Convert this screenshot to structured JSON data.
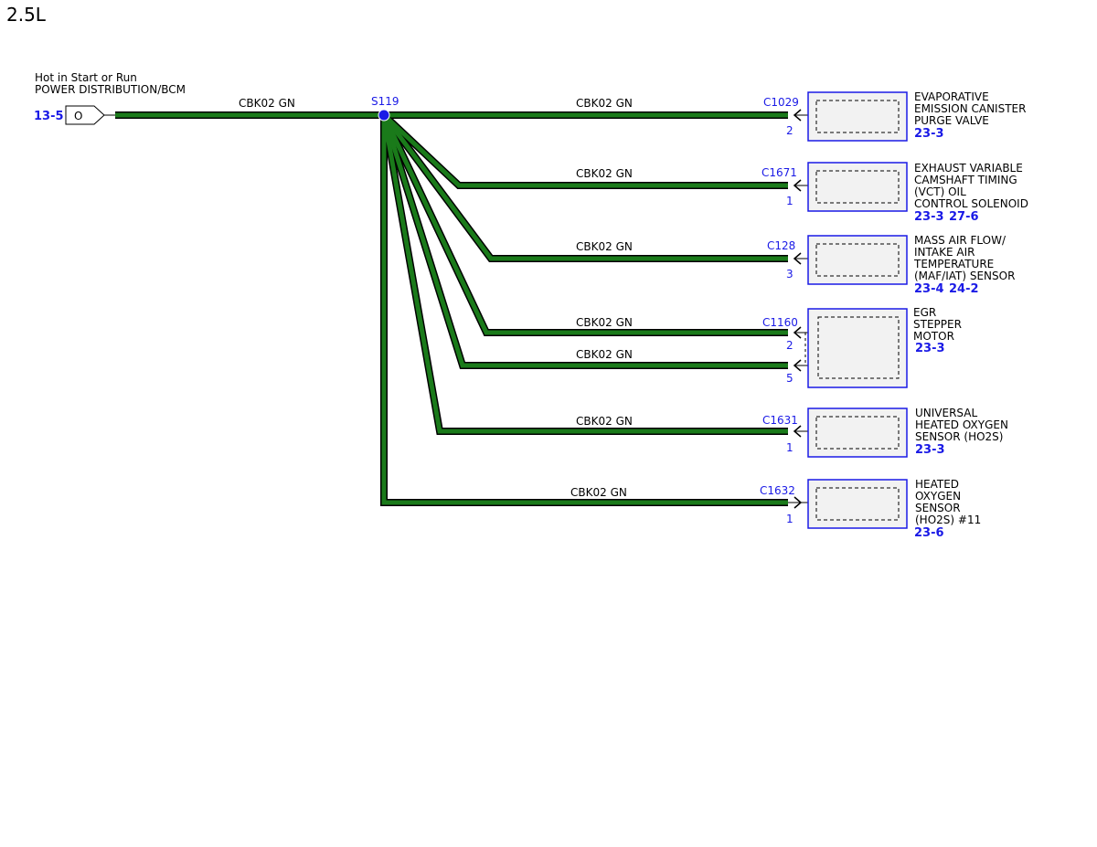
{
  "title": "2.5L",
  "source": {
    "line1": "Hot in Start or Run",
    "line2": "POWER DISTRIBUTION/BCM",
    "ref": "13-5",
    "pin": "O"
  },
  "splice": "S119",
  "main_wire": "CBK02  GN",
  "branches": [
    {
      "wire": "CBK02  GN",
      "connector": "C1029",
      "pin": "2",
      "component": [
        "EVAPORATIVE",
        "EMISSION CANISTER",
        "PURGE VALVE"
      ],
      "refs": [
        "23-3"
      ]
    },
    {
      "wire": "CBK02  GN",
      "connector": "C1671",
      "pin": "1",
      "component": [
        "EXHAUST VARIABLE",
        "CAMSHAFT TIMING",
        "(VCT) OIL",
        "CONTROL SOLENOID"
      ],
      "refs": [
        "23-3",
        "27-6"
      ]
    },
    {
      "wire": "CBK02  GN",
      "connector": "C128",
      "pin": "3",
      "component": [
        "MASS AIR FLOW/",
        "INTAKE AIR",
        "TEMPERATURE",
        "(MAF/IAT) SENSOR"
      ],
      "refs": [
        "23-4",
        "24-2"
      ]
    },
    {
      "wire": "CBK02  GN",
      "wire2": "CBK02  GN",
      "connector": "C1160",
      "pin": "2",
      "pin2": "5",
      "component": [
        "EGR",
        "STEPPER",
        "MOTOR"
      ],
      "refs": [
        "23-3"
      ]
    },
    {
      "wire": "CBK02  GN",
      "connector": "C1631",
      "pin": "1",
      "component": [
        "UNIVERSAL",
        "HEATED OXYGEN",
        "SENSOR (HO2S)"
      ],
      "refs": [
        "23-3"
      ]
    },
    {
      "wire": "CBK02  GN",
      "connector": "C1632",
      "pin": "1",
      "component": [
        "HEATED",
        "OXYGEN",
        "SENSOR",
        "(HO2S) #11"
      ],
      "refs": [
        "23-6"
      ]
    }
  ],
  "colors": {
    "wire": "#1a7a1a",
    "wire_outline": "#000000",
    "connector_label": "#1a1ae6",
    "component_box": "#1a1ae6",
    "component_fill": "#f2f2f2"
  }
}
